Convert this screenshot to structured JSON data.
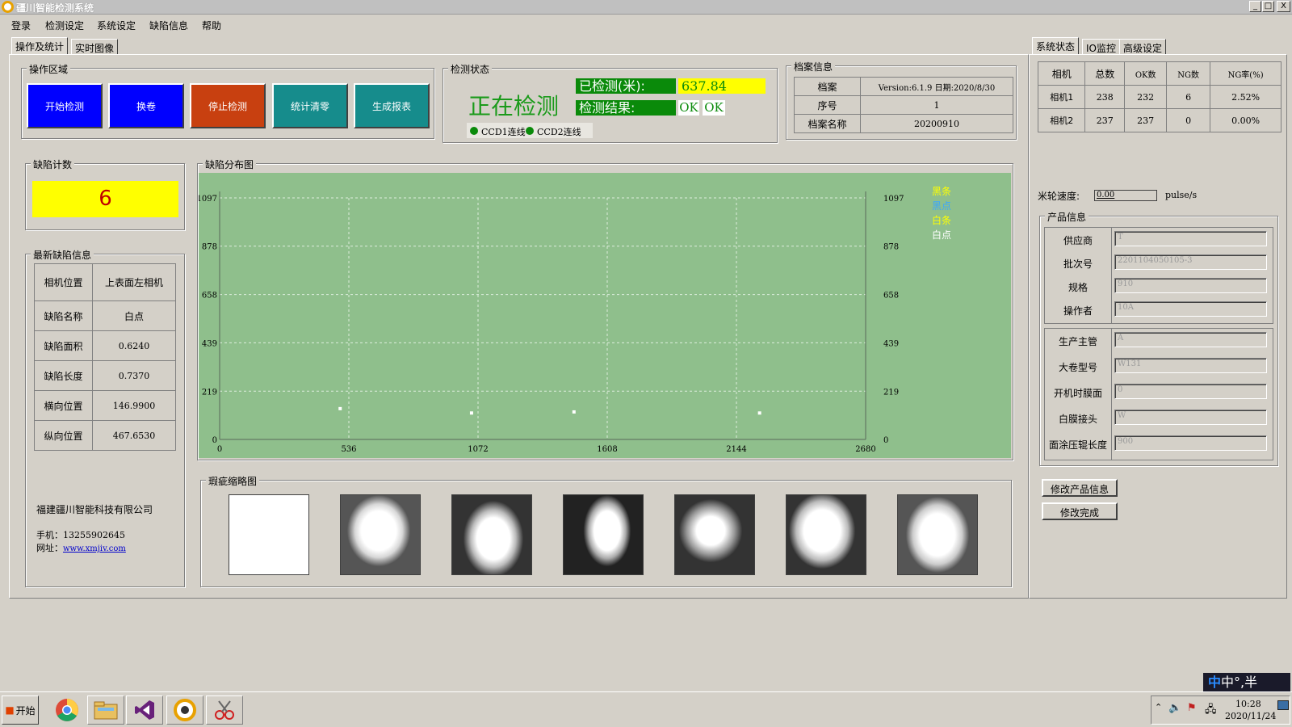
{
  "window": {
    "title": "疆川智能检测系统",
    "min": "_",
    "max": "□",
    "close": "X"
  },
  "menu": [
    "登录",
    "检测设定",
    "系统设定",
    "缺陷信息",
    "帮助"
  ],
  "left_tabs": [
    "操作及统计",
    "实时图像"
  ],
  "right_tabs": [
    "系统状态",
    "IO监控",
    "高级设定"
  ],
  "operation": {
    "title": "操作区域",
    "buttons": [
      {
        "label": "开始检测",
        "color": "#0000ff"
      },
      {
        "label": "换卷",
        "color": "#0000ff"
      },
      {
        "label": "停止检测",
        "color": "#c84010"
      },
      {
        "label": "统计清零",
        "color": "#168c8c"
      },
      {
        "label": "生成报表",
        "color": "#168c8c"
      }
    ]
  },
  "status": {
    "title": "检测状态",
    "state": "正在检测",
    "detected_label": "已检测(米):",
    "detected_value": "637.84",
    "result_label": "检测结果:",
    "result_values": [
      "OK",
      "OK"
    ],
    "ccd": [
      "CCD1连线",
      "CCD2连线"
    ]
  },
  "archive": {
    "title": "档案信息",
    "rows": [
      [
        "档案",
        "Version:6.1.9 日期:2020/8/30"
      ],
      [
        "序号",
        "1"
      ],
      [
        "档案名称",
        "20200910"
      ]
    ]
  },
  "defect_count": {
    "title": "缺陷计数",
    "value": "6"
  },
  "latest_defect": {
    "title": "最新缺陷信息",
    "rows": [
      [
        "相机位置",
        "上表面左相机"
      ],
      [
        "缺陷名称",
        "白点"
      ],
      [
        "缺陷面积",
        "0.6240"
      ],
      [
        "缺陷长度",
        "0.7370"
      ],
      [
        "横向位置",
        "146.9900"
      ],
      [
        "纵向位置",
        "467.6530"
      ]
    ]
  },
  "company": {
    "name": "福建疆川智能科技有限公司",
    "phone": "手机：13255902645",
    "web_label": "网址：",
    "web": "www.xmjiv.com"
  },
  "distribution": {
    "title": "缺陷分布图"
  },
  "chart_data": {
    "type": "scatter",
    "xlim": [
      0,
      2680
    ],
    "ylim": [
      0,
      1097
    ],
    "x_ticks": [
      "0",
      "536",
      "1072",
      "1608",
      "2144",
      "2680"
    ],
    "y_ticks": [
      "0",
      "219",
      "439",
      "658",
      "878",
      "1097"
    ],
    "legend": [
      {
        "name": "黑条",
        "color": "#ffff00"
      },
      {
        "name": "黑点",
        "color": "#3aa6ff"
      },
      {
        "name": "白条",
        "color": "#ffff00"
      },
      {
        "name": "白点",
        "color": "#ffffff"
      }
    ],
    "points": [
      [
        500,
        140
      ],
      [
        1045,
        120
      ],
      [
        1470,
        125
      ],
      [
        2240,
        120
      ]
    ],
    "grid": true,
    "background": "#8fbf8c"
  },
  "thumbs": {
    "title": "瑕疵缩略图",
    "count": 7
  },
  "camera_table": {
    "headers": [
      "相机",
      "总数",
      "OK数",
      "NG数",
      "NG率(%)"
    ],
    "rows": [
      [
        "相机1",
        "238",
        "232",
        "6",
        "2.52%"
      ],
      [
        "相机2",
        "237",
        "237",
        "0",
        "0.00%"
      ]
    ]
  },
  "speed": {
    "label": "米轮速度:",
    "value": "0.00",
    "unit": "pulse/s"
  },
  "product": {
    "title": "产品信息",
    "group1": [
      {
        "label": "供应商",
        "value": "T"
      },
      {
        "label": "批次号",
        "value": "2201104050105-3"
      },
      {
        "label": "规格",
        "value": "910"
      },
      {
        "label": "操作者",
        "value": "10A"
      }
    ],
    "group2": [
      {
        "label": "生产主管",
        "value": "A"
      },
      {
        "label": "大卷型号",
        "value": "W131"
      },
      {
        "label": "开机时膜面",
        "value": "0"
      },
      {
        "label": "白膜接头",
        "value": "W"
      },
      {
        "label": "面涂压辊长度",
        "value": "900"
      }
    ],
    "edit_button": "修改产品信息",
    "done_button": "修改完成"
  },
  "ime": {
    "text": "中°,半"
  },
  "taskbar": {
    "start": "开始",
    "time": "10:28",
    "date": "2020/11/24"
  }
}
